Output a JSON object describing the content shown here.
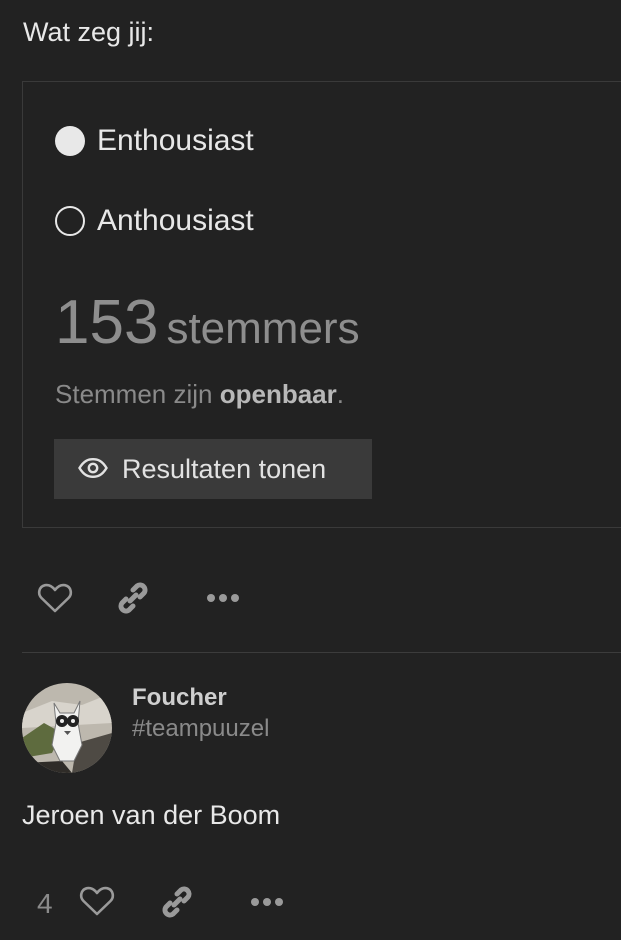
{
  "poll": {
    "question": "Wat zeg jij:",
    "options": [
      {
        "label": "Enthousiast",
        "selected": true
      },
      {
        "label": "Anthousiast",
        "selected": false
      }
    ],
    "voters_count": "153",
    "voters_word": "stemmers",
    "visibility_prefix": "Stemmen zijn",
    "visibility_value": "openbaar",
    "visibility_suffix": ".",
    "results_button": "Resultaten tonen"
  },
  "post1_actions": {
    "icons": [
      "heart-icon",
      "link-icon",
      "more-icon"
    ]
  },
  "post2": {
    "username": "Foucher",
    "user_title": "#teampuuzel",
    "body": "Jeroen van der Boom",
    "like_count": "4"
  },
  "colors": {
    "background": "#222222",
    "text": "#e8e8e8",
    "muted": "#8a8a8a",
    "button": "#3a3a3a"
  }
}
